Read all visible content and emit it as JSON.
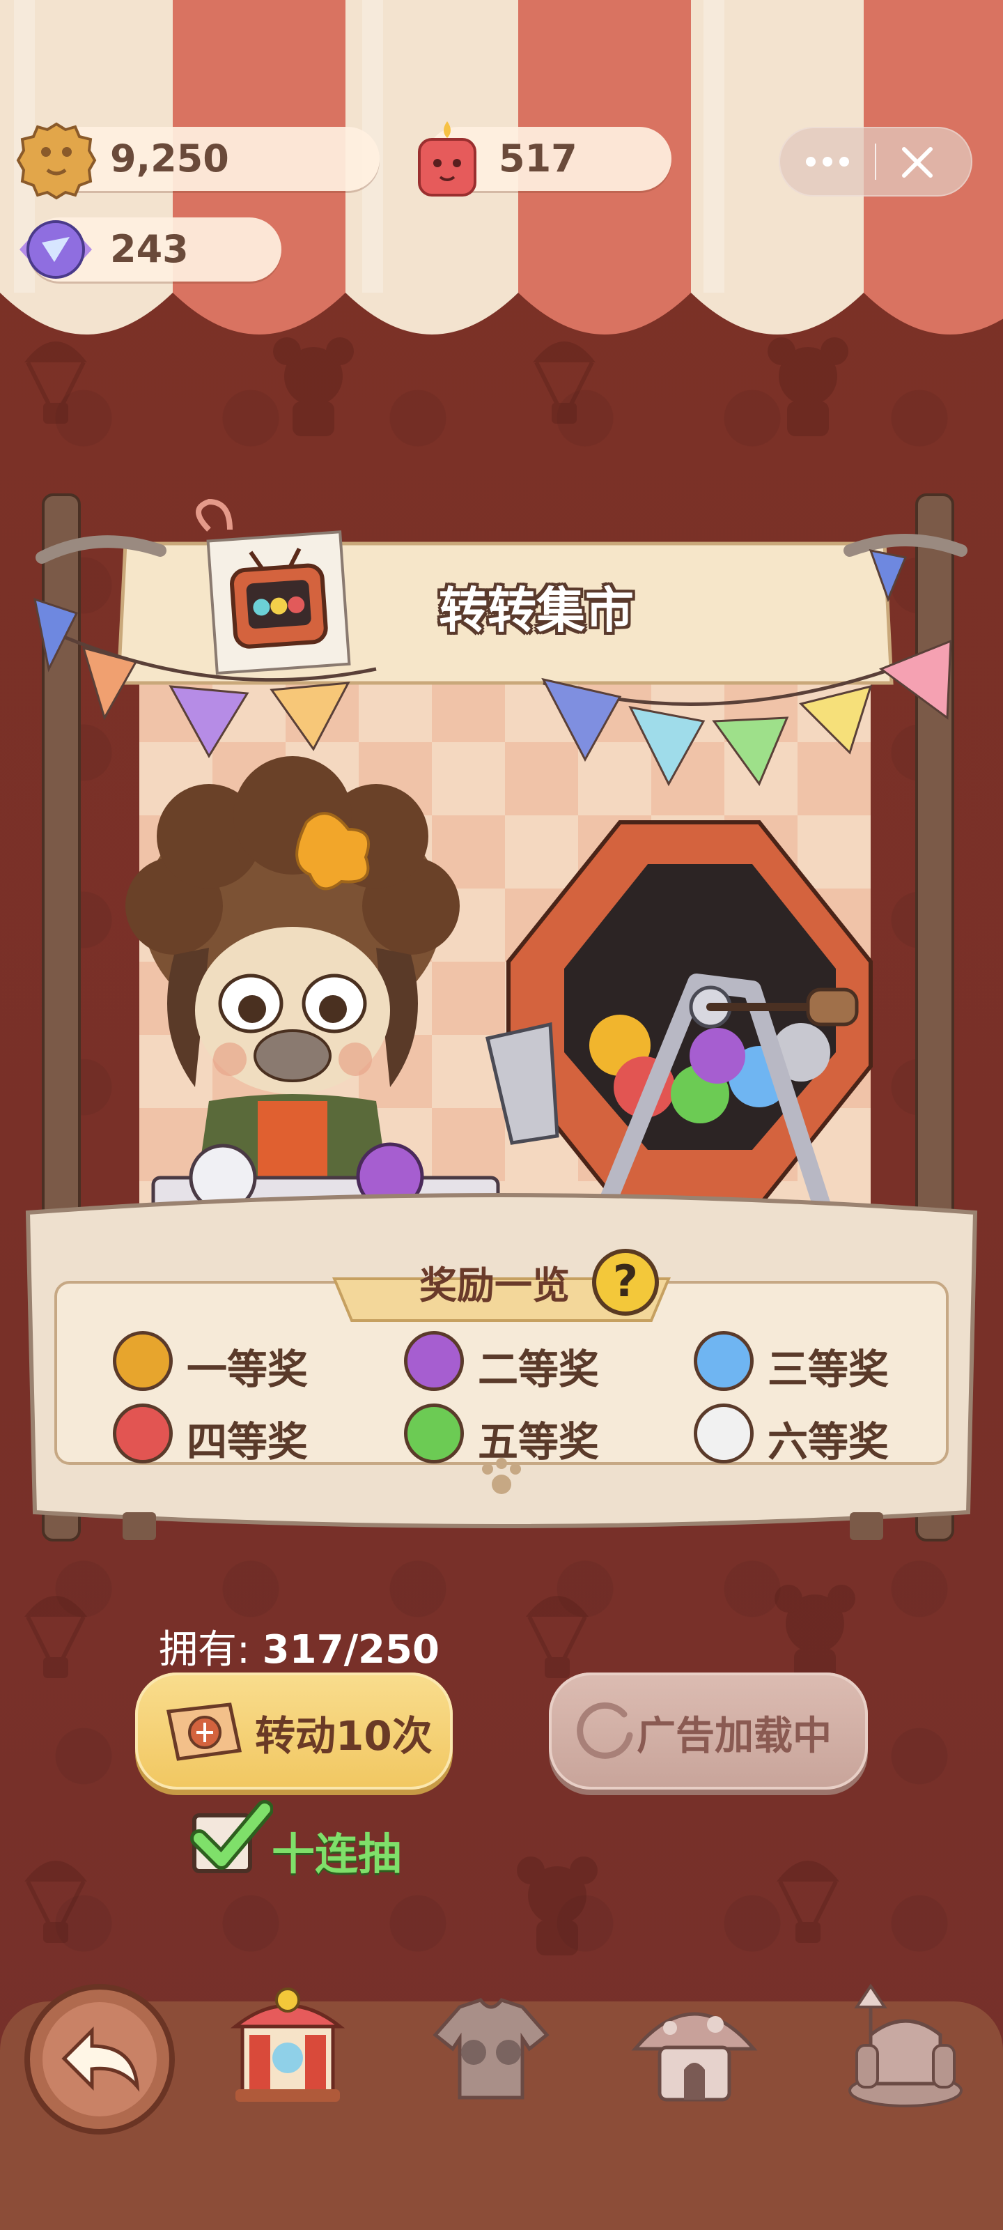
{
  "colors": {
    "background": "#7a2f24",
    "awning_cream": "#f3e3cf",
    "awning_red": "#d97361",
    "accent_gold": "#f1c761",
    "check_green": "#7fe06a"
  },
  "currency": {
    "cookies": {
      "icon": "cookie-icon",
      "value": "9,250"
    },
    "candles": {
      "icon": "candle-icon",
      "value": "517"
    },
    "gems": {
      "icon": "gem-candy-icon",
      "value": "243"
    }
  },
  "capsule": {
    "more_icon": "ellipsis-icon",
    "close_icon": "close-icon"
  },
  "stall": {
    "title": "转转集市",
    "tv_icon": "tv-gacha-icon"
  },
  "rewards": {
    "title": "奖励一览",
    "help_symbol": "?",
    "prizes": [
      {
        "label": "一等奖",
        "color": "#e7a52d"
      },
      {
        "label": "二等奖",
        "color": "#a65ed0"
      },
      {
        "label": "三等奖",
        "color": "#6fb5f2"
      },
      {
        "label": "四等奖",
        "color": "#e25552"
      },
      {
        "label": "五等奖",
        "color": "#6ccb54"
      },
      {
        "label": "六等奖",
        "color": "#f1f1f1"
      }
    ]
  },
  "controls": {
    "own_label": "拥有: ",
    "own_value": "317/250",
    "spin_button": "转动10次",
    "ad_button": "广告加载中",
    "ten_draw_label": "十连抽",
    "ten_draw_checked": true
  },
  "nav": {
    "items": [
      {
        "icon": "back-arrow-icon"
      },
      {
        "icon": "carousel-stall-icon"
      },
      {
        "icon": "clothes-icon"
      },
      {
        "icon": "mushroom-house-icon"
      },
      {
        "icon": "furniture-icon"
      }
    ]
  }
}
